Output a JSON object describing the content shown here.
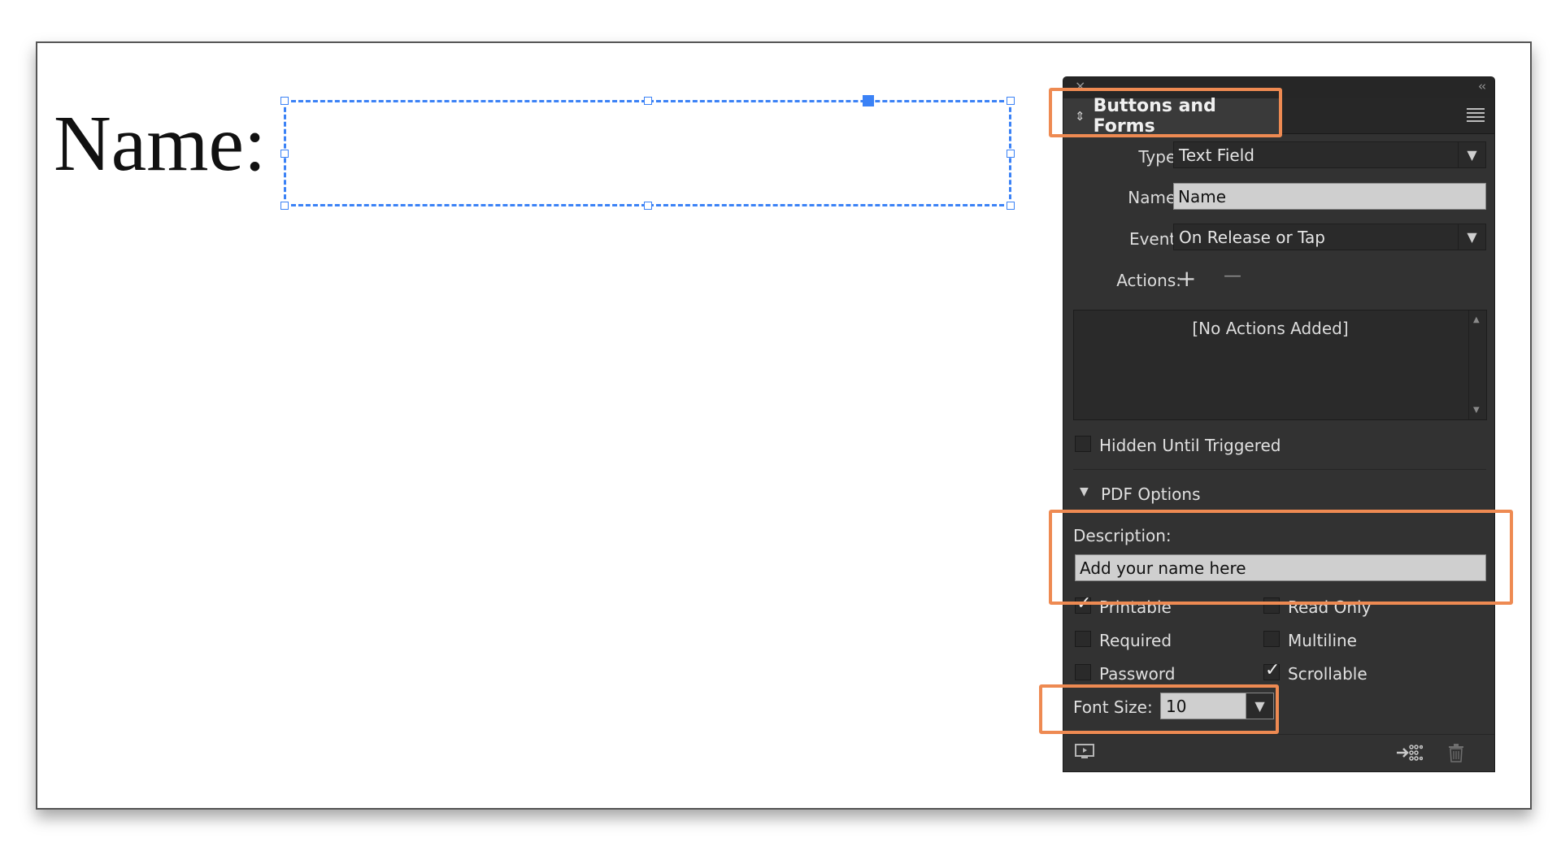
{
  "document": {
    "name_label": "Name:"
  },
  "panel": {
    "title": "Buttons and Forms",
    "type": {
      "label": "Type:",
      "value": "Text Field"
    },
    "name": {
      "label": "Name:",
      "value": "Name"
    },
    "event": {
      "label": "Event:",
      "value": "On Release or Tap"
    },
    "actions": {
      "label": "Actions:",
      "add": "+",
      "remove": "—",
      "empty": "[No Actions Added]"
    },
    "hidden_until_triggered": {
      "label": "Hidden Until Triggered",
      "checked": false
    },
    "pdf_options": {
      "title": "PDF Options",
      "description_label": "Description:",
      "description_value": "Add your name here",
      "printable": {
        "label": "Printable",
        "checked": true
      },
      "read_only": {
        "label": "Read Only",
        "checked": false
      },
      "required": {
        "label": "Required",
        "checked": false
      },
      "multiline": {
        "label": "Multiline",
        "checked": false
      },
      "password": {
        "label": "Password",
        "checked": false
      },
      "scrollable": {
        "label": "Scrollable",
        "checked": true
      },
      "font_size": {
        "label": "Font Size:",
        "value": "10"
      }
    }
  },
  "colors": {
    "highlight": "#ee8a52",
    "selection": "#3b82f6",
    "panel_bg": "#323232"
  }
}
